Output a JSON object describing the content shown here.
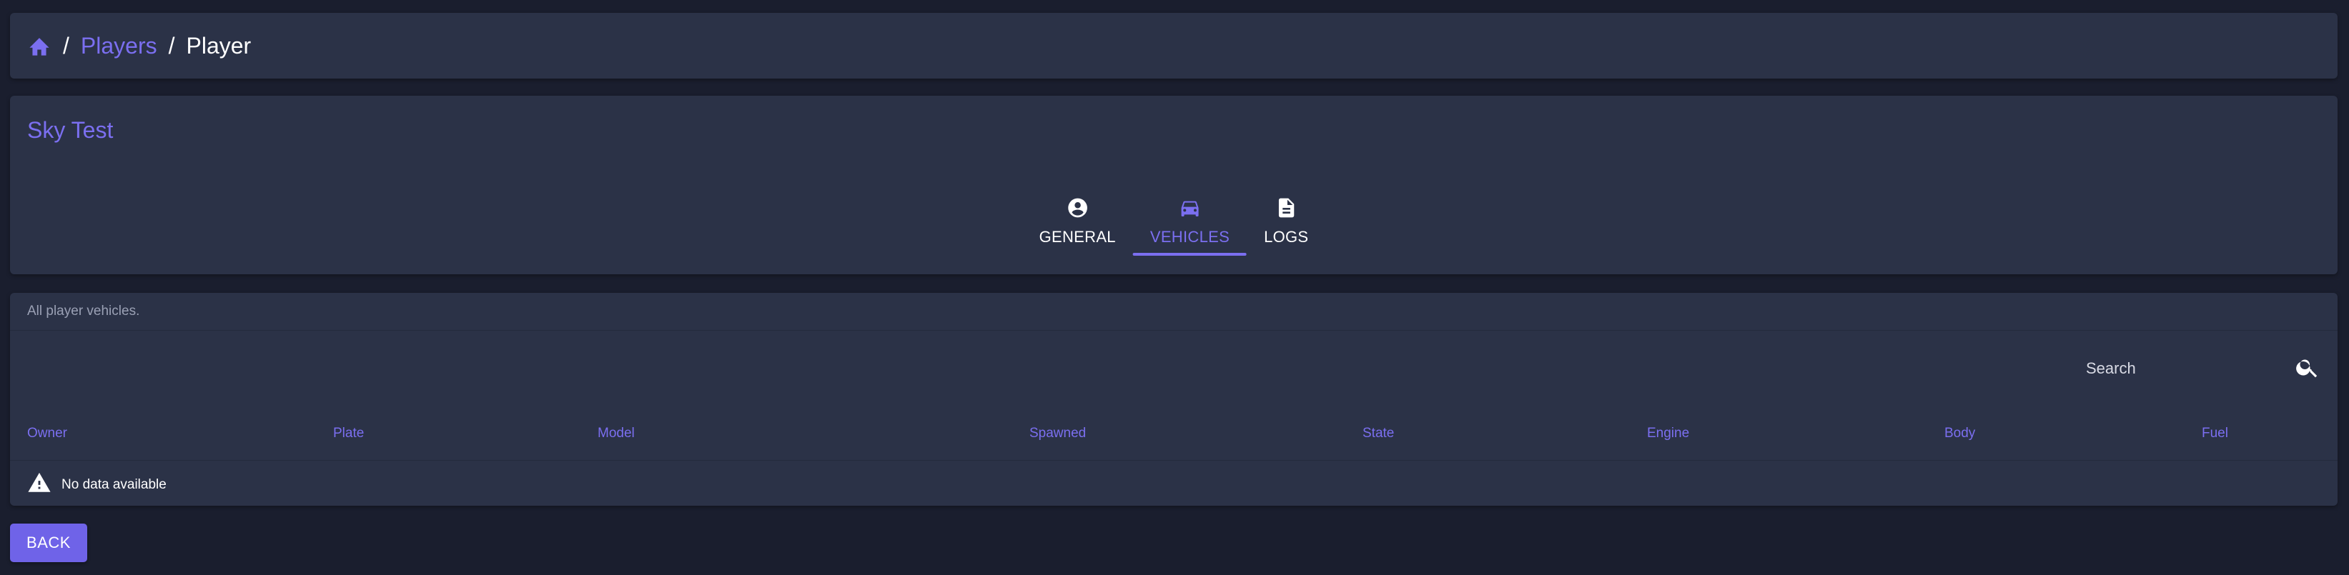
{
  "breadcrumb": {
    "home_icon": "home-icon",
    "separator": "/",
    "items": [
      {
        "label": "Players"
      },
      {
        "label": "Player"
      }
    ]
  },
  "player": {
    "name": "Sky Test",
    "tabs": [
      {
        "label": "GENERAL",
        "icon": "account-circle-icon",
        "active": false
      },
      {
        "label": "VEHICLES",
        "icon": "car-icon",
        "active": true
      },
      {
        "label": "LOGS",
        "icon": "document-icon",
        "active": false
      }
    ]
  },
  "vehicles": {
    "subtitle": "All player vehicles.",
    "search": {
      "placeholder": "Search",
      "value": ""
    },
    "columns": [
      "Owner",
      "Plate",
      "Model",
      "Spawned",
      "State",
      "Engine",
      "Body",
      "Fuel"
    ],
    "empty_message": "No data available"
  },
  "actions": {
    "back_label": "BACK"
  },
  "colors": {
    "accent": "#7b6ff0",
    "background": "#1a1e2e",
    "card": "#2b3247",
    "button": "#6f63e8"
  }
}
